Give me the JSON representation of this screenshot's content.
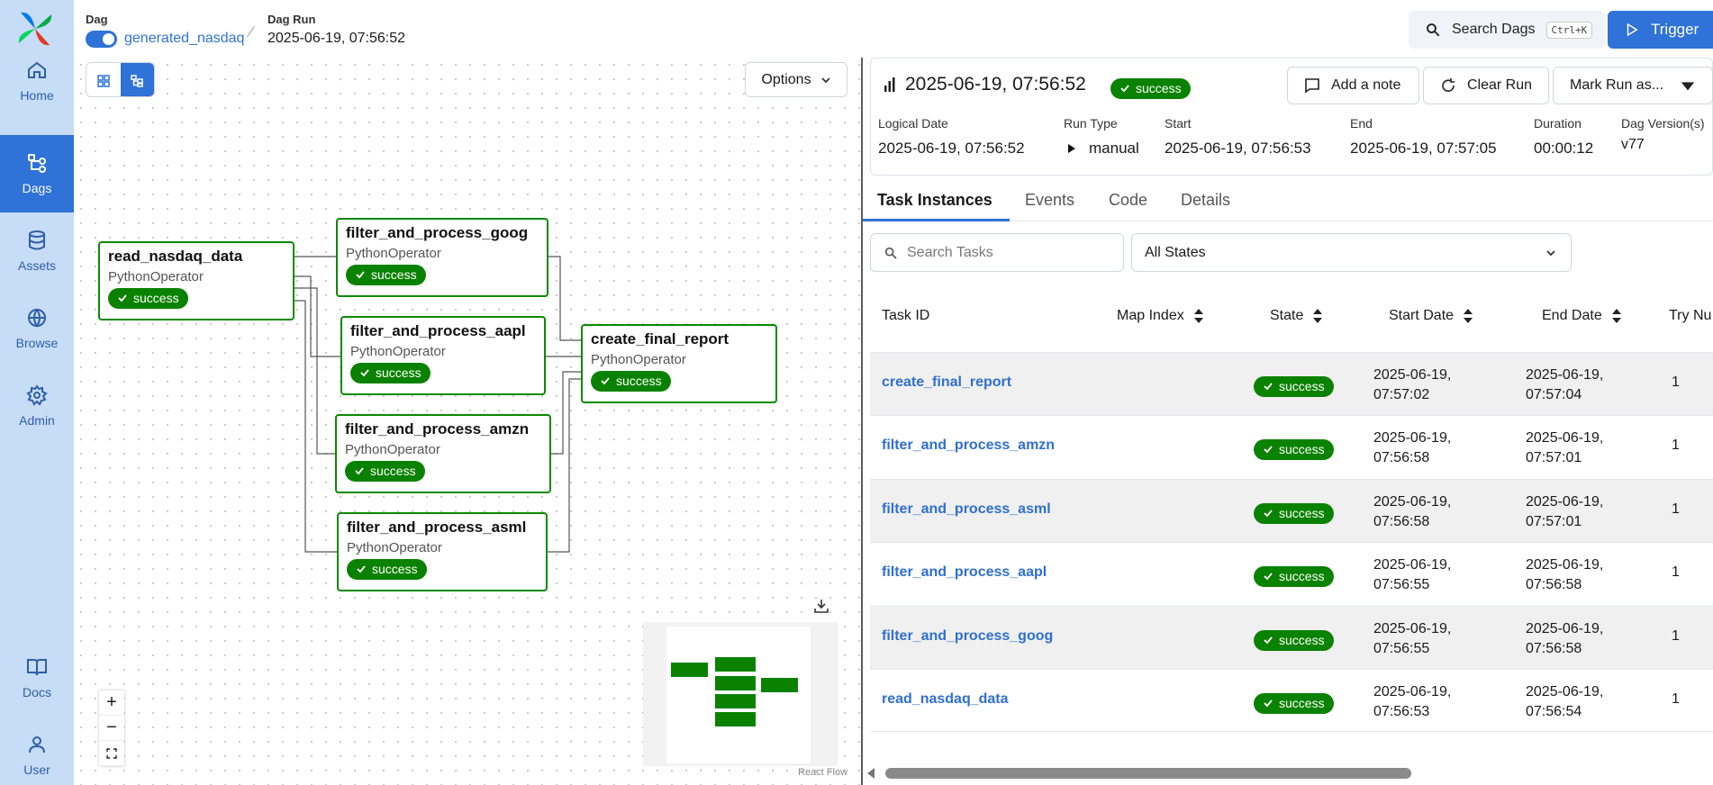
{
  "header": {
    "dag_label": "Dag",
    "dag_name": "generated_nasdaq",
    "dagrun_label": "Dag Run",
    "dagrun_value": "2025-06-19, 07:56:52",
    "search_label": "Search Dags",
    "search_shortcut": "Ctrl+K",
    "trigger_label": "Trigger"
  },
  "sidebar": {
    "items": [
      {
        "label": "Home",
        "icon": "home-icon"
      },
      {
        "label": "Dags",
        "icon": "dags-icon"
      },
      {
        "label": "Assets",
        "icon": "database-icon"
      },
      {
        "label": "Browse",
        "icon": "globe-icon"
      },
      {
        "label": "Admin",
        "icon": "gear-icon"
      },
      {
        "label": "Docs",
        "icon": "book-icon"
      },
      {
        "label": "User",
        "icon": "user-icon"
      }
    ]
  },
  "graph": {
    "options_label": "Options",
    "react_flow_label": "React Flow",
    "nodes": [
      {
        "name": "read_nasdaq_data",
        "operator": "PythonOperator",
        "state": "success"
      },
      {
        "name": "filter_and_process_goog",
        "operator": "PythonOperator",
        "state": "success"
      },
      {
        "name": "filter_and_process_aapl",
        "operator": "PythonOperator",
        "state": "success"
      },
      {
        "name": "filter_and_process_amzn",
        "operator": "PythonOperator",
        "state": "success"
      },
      {
        "name": "filter_and_process_asml",
        "operator": "PythonOperator",
        "state": "success"
      },
      {
        "name": "create_final_report",
        "operator": "PythonOperator",
        "state": "success"
      }
    ]
  },
  "run": {
    "title": "2025-06-19, 07:56:52",
    "state": "success",
    "add_note": "Add a note",
    "clear_run": "Clear Run",
    "mark_run": "Mark Run as...",
    "meta": {
      "logical_date_label": "Logical Date",
      "logical_date": "2025-06-19, 07:56:52",
      "run_type_label": "Run Type",
      "run_type": "manual",
      "start_label": "Start",
      "start": "2025-06-19, 07:56:53",
      "end_label": "End",
      "end": "2025-06-19, 07:57:05",
      "duration_label": "Duration",
      "duration": "00:00:12",
      "version_label": "Dag Version(s)",
      "version": "v77"
    }
  },
  "tabs": [
    "Task Instances",
    "Events",
    "Code",
    "Details"
  ],
  "filters": {
    "search_placeholder": "Search Tasks",
    "state_value": "All States"
  },
  "table": {
    "columns": [
      "Task ID",
      "Map Index",
      "State",
      "Start Date",
      "End Date",
      "Try Nu"
    ],
    "rows": [
      {
        "task_id": "create_final_report",
        "state": "success",
        "start_a": "2025-06-19,",
        "start_b": "07:57:02",
        "end_a": "2025-06-19,",
        "end_b": "07:57:04",
        "try": "1"
      },
      {
        "task_id": "filter_and_process_amzn",
        "state": "success",
        "start_a": "2025-06-19,",
        "start_b": "07:56:58",
        "end_a": "2025-06-19,",
        "end_b": "07:57:01",
        "try": "1"
      },
      {
        "task_id": "filter_and_process_asml",
        "state": "success",
        "start_a": "2025-06-19,",
        "start_b": "07:56:58",
        "end_a": "2025-06-19,",
        "end_b": "07:57:01",
        "try": "1"
      },
      {
        "task_id": "filter_and_process_aapl",
        "state": "success",
        "start_a": "2025-06-19,",
        "start_b": "07:56:55",
        "end_a": "2025-06-19,",
        "end_b": "07:56:58",
        "try": "1"
      },
      {
        "task_id": "filter_and_process_goog",
        "state": "success",
        "start_a": "2025-06-19,",
        "start_b": "07:56:55",
        "end_a": "2025-06-19,",
        "end_b": "07:56:58",
        "try": "1"
      },
      {
        "task_id": "read_nasdaq_data",
        "state": "success",
        "start_a": "2025-06-19,",
        "start_b": "07:56:53",
        "end_a": "2025-06-19,",
        "end_b": "07:56:54",
        "try": "1"
      }
    ]
  },
  "colors": {
    "accent": "#2f72d8",
    "success": "#0a8200",
    "sidebar": "#c7dcf7"
  }
}
